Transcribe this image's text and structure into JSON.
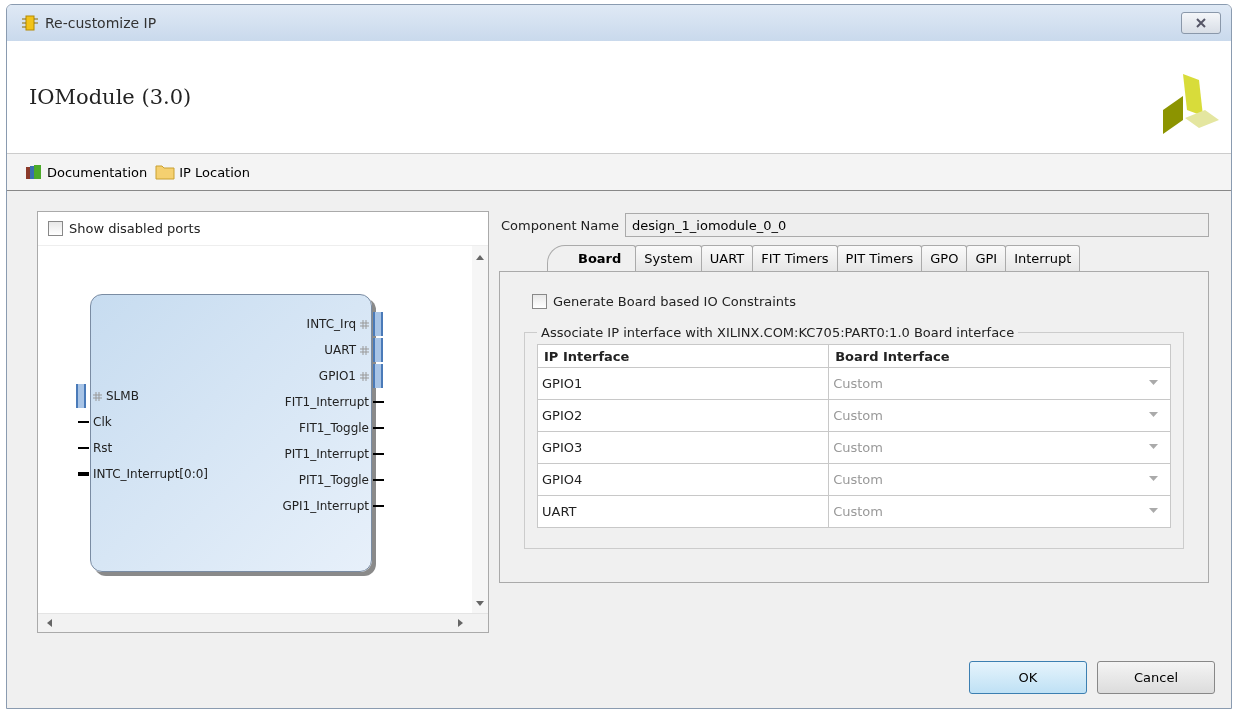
{
  "window": {
    "title": "Re-customize IP"
  },
  "header": {
    "title": "IOModule (3.0)"
  },
  "toolbar": [
    {
      "kind": "books",
      "label": "Documentation"
    },
    {
      "kind": "folder",
      "label": "IP Location"
    }
  ],
  "left_panel": {
    "show_disabled_ports": {
      "label": "Show disabled ports",
      "checked": false
    },
    "block": {
      "left_ports": [
        {
          "kind": "bus",
          "name": "SLMB"
        },
        {
          "kind": "wire",
          "name": "Clk"
        },
        {
          "kind": "wire",
          "name": "Rst"
        },
        {
          "kind": "vector",
          "name": "INTC_Interrupt[0:0]"
        }
      ],
      "right_ports": [
        {
          "kind": "bus",
          "name": "INTC_Irq"
        },
        {
          "kind": "bus",
          "name": "UART"
        },
        {
          "kind": "bus",
          "name": "GPIO1"
        },
        {
          "kind": "wire",
          "name": "FIT1_Interrupt"
        },
        {
          "kind": "wire",
          "name": "FIT1_Toggle"
        },
        {
          "kind": "wire",
          "name": "PIT1_Interrupt"
        },
        {
          "kind": "wire",
          "name": "PIT1_Toggle"
        },
        {
          "kind": "wire",
          "name": "GPI1_Interrupt"
        }
      ]
    }
  },
  "component_name": {
    "label": "Component Name",
    "value": "design_1_iomodule_0_0"
  },
  "tabs": [
    {
      "label": "Board",
      "selected": true
    },
    {
      "label": "System",
      "selected": false
    },
    {
      "label": "UART",
      "selected": false
    },
    {
      "label": "FIT Timers",
      "selected": false
    },
    {
      "label": "PIT Timers",
      "selected": false
    },
    {
      "label": "GPO",
      "selected": false
    },
    {
      "label": "GPI",
      "selected": false
    },
    {
      "label": "Interrupt",
      "selected": false
    }
  ],
  "board": {
    "generate_constraints": {
      "label": "Generate Board based IO Constraints",
      "checked": false
    },
    "group_title": "Associate IP interface with XILINX.COM:KC705:PART0:1.0 Board interface",
    "table": {
      "columns": [
        "IP Interface",
        "Board Interface"
      ],
      "rows": [
        {
          "ip": "GPIO1",
          "board": "Custom"
        },
        {
          "ip": "GPIO2",
          "board": "Custom"
        },
        {
          "ip": "GPIO3",
          "board": "Custom"
        },
        {
          "ip": "GPIO4",
          "board": "Custom"
        },
        {
          "ip": "UART",
          "board": "Custom"
        }
      ]
    }
  },
  "buttons": [
    {
      "label": "OK",
      "kind": "default"
    },
    {
      "label": "Cancel",
      "kind": "normal"
    }
  ]
}
